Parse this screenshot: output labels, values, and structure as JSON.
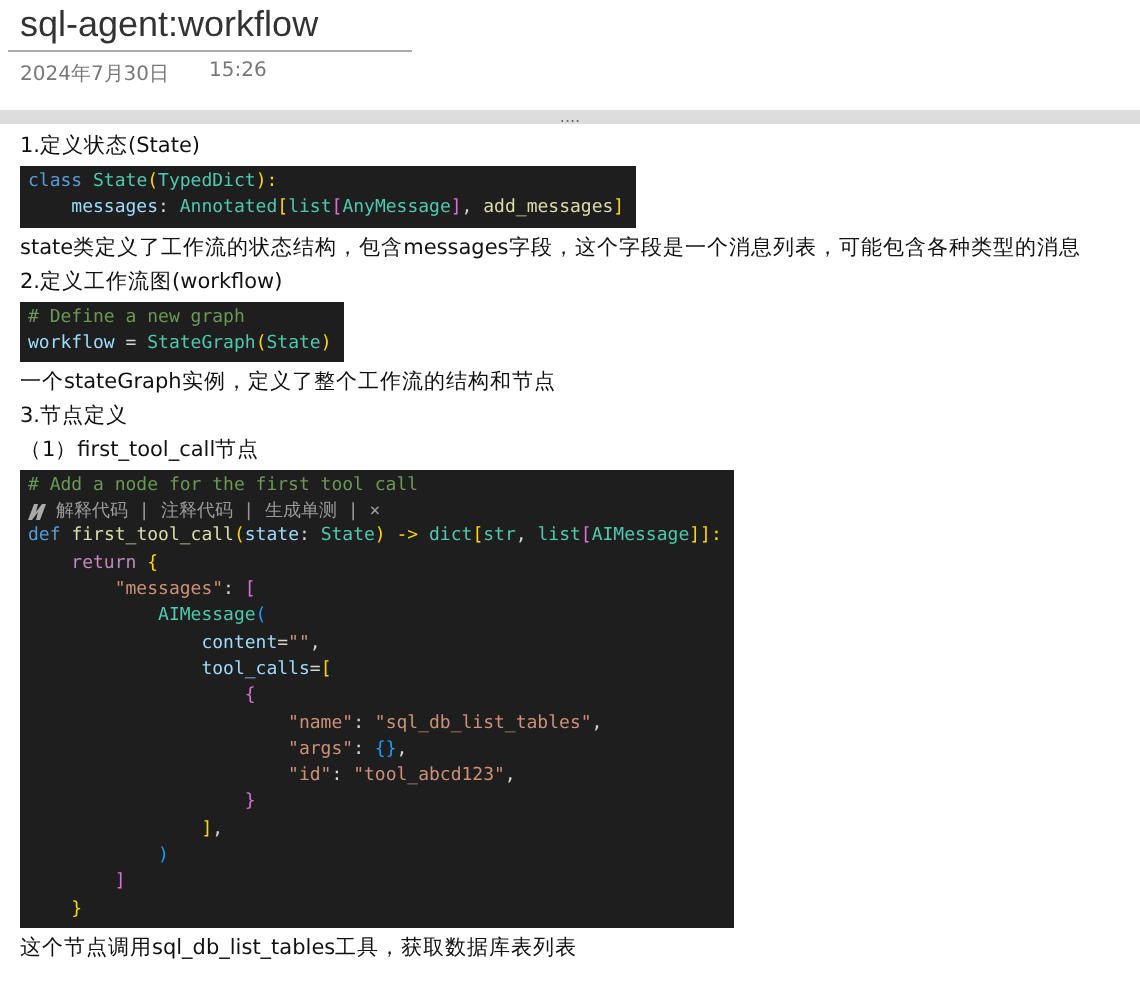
{
  "title": "sql-agent:workflow",
  "date": "2024年7月30日",
  "time": "15:26",
  "divider_handle": "....",
  "blocks": [
    {
      "kind": "text",
      "text": "1.定义状态(State)"
    },
    {
      "kind": "code",
      "lines": [
        [
          {
            "text": "class ",
            "color": "#569cd6"
          },
          {
            "text": "State",
            "color": "#4ec9b0"
          },
          {
            "text": "(",
            "color": "#ffd700"
          },
          {
            "text": "TypedDict",
            "color": "#4ec9b0"
          },
          {
            "text": "):",
            "color": "#ffd700"
          }
        ],
        [
          {
            "text": "    messages",
            "color": "#9cdcfe"
          },
          {
            "text": ": ",
            "color": "#d4d4d4"
          },
          {
            "text": "Annotated",
            "color": "#4ec9b0"
          },
          {
            "text": "[",
            "color": "#ffd700"
          },
          {
            "text": "list",
            "color": "#4ec9b0"
          },
          {
            "text": "[",
            "color": "#da70d6"
          },
          {
            "text": "AnyMessage",
            "color": "#4ec9b0"
          },
          {
            "text": "]",
            "color": "#da70d6"
          },
          {
            "text": ", ",
            "color": "#d4d4d4"
          },
          {
            "text": "add_messages",
            "color": "#dcdcaa"
          },
          {
            "text": "]",
            "color": "#ffd700"
          }
        ]
      ]
    },
    {
      "kind": "text",
      "text": "state类定义了工作流的状态结构，包含messages字段，这个字段是一个消息列表，可能包含各种类型的消息"
    },
    {
      "kind": "text",
      "text": "2.定义工作流图(workflow)"
    },
    {
      "kind": "code",
      "lines": [
        [
          {
            "text": "# Define a new graph",
            "color": "#6a9955"
          }
        ],
        [
          {
            "text": "workflow",
            "color": "#9cdcfe"
          },
          {
            "text": " = ",
            "color": "#d4d4d4"
          },
          {
            "text": "StateGraph",
            "color": "#4ec9b0"
          },
          {
            "text": "(",
            "color": "#ffd700"
          },
          {
            "text": "State",
            "color": "#4ec9b0"
          },
          {
            "text": ")",
            "color": "#ffd700"
          }
        ]
      ]
    },
    {
      "kind": "text",
      "text": "一个stateGraph实例，定义了整个工作流的结构和节点"
    },
    {
      "kind": "text",
      "text": "3.节点定义"
    },
    {
      "kind": "text",
      "text": "（1）first_tool_call节点"
    },
    {
      "kind": "code",
      "lens": "解释代码 | 注释代码 | 生成单测 | ×",
      "lines": [
        [
          {
            "text": "# Add a node for the first tool call",
            "color": "#6a9955"
          }
        ],
        [
          {
            "text": "def ",
            "color": "#569cd6"
          },
          {
            "text": "first_tool_call",
            "color": "#dcdcaa"
          },
          {
            "text": "(",
            "color": "#ffd700"
          },
          {
            "text": "state",
            "color": "#9cdcfe"
          },
          {
            "text": ": ",
            "color": "#d4d4d4"
          },
          {
            "text": "State",
            "color": "#4ec9b0"
          },
          {
            "text": ") -> ",
            "color": "#ffd700"
          },
          {
            "text": "dict",
            "color": "#4ec9b0"
          },
          {
            "text": "[",
            "color": "#ffd700"
          },
          {
            "text": "str",
            "color": "#4ec9b0"
          },
          {
            "text": ", ",
            "color": "#d4d4d4"
          },
          {
            "text": "list",
            "color": "#4ec9b0"
          },
          {
            "text": "[",
            "color": "#da70d6"
          },
          {
            "text": "AIMessage",
            "color": "#4ec9b0"
          },
          {
            "text": "]]:",
            "color": "#ffd700"
          }
        ],
        [
          {
            "text": "    return ",
            "color": "#c586c0"
          },
          {
            "text": "{",
            "color": "#ffd700"
          }
        ],
        [
          {
            "text": "        \"messages\"",
            "color": "#ce9178"
          },
          {
            "text": ": ",
            "color": "#d4d4d4"
          },
          {
            "text": "[",
            "color": "#da70d6"
          }
        ],
        [
          {
            "text": "            AIMessage",
            "color": "#4ec9b0"
          },
          {
            "text": "(",
            "color": "#179fff"
          }
        ],
        [
          {
            "text": "                content",
            "color": "#9cdcfe"
          },
          {
            "text": "=",
            "color": "#d4d4d4"
          },
          {
            "text": "\"\"",
            "color": "#ce9178"
          },
          {
            "text": ",",
            "color": "#d4d4d4"
          }
        ],
        [
          {
            "text": "                tool_calls",
            "color": "#9cdcfe"
          },
          {
            "text": "=",
            "color": "#d4d4d4"
          },
          {
            "text": "[",
            "color": "#ffd700"
          }
        ],
        [
          {
            "text": "                    {",
            "color": "#da70d6"
          }
        ],
        [
          {
            "text": "                        \"name\"",
            "color": "#ce9178"
          },
          {
            "text": ": ",
            "color": "#d4d4d4"
          },
          {
            "text": "\"sql_db_list_tables\"",
            "color": "#ce9178"
          },
          {
            "text": ",",
            "color": "#d4d4d4"
          }
        ],
        [
          {
            "text": "                        \"args\"",
            "color": "#ce9178"
          },
          {
            "text": ": ",
            "color": "#d4d4d4"
          },
          {
            "text": "{}",
            "color": "#179fff"
          },
          {
            "text": ",",
            "color": "#d4d4d4"
          }
        ],
        [
          {
            "text": "                        \"id\"",
            "color": "#ce9178"
          },
          {
            "text": ": ",
            "color": "#d4d4d4"
          },
          {
            "text": "\"tool_abcd123\"",
            "color": "#ce9178"
          },
          {
            "text": ",",
            "color": "#d4d4d4"
          }
        ],
        [
          {
            "text": "                    }",
            "color": "#da70d6"
          }
        ],
        [
          {
            "text": "                ]",
            "color": "#ffd700"
          },
          {
            "text": ",",
            "color": "#d4d4d4"
          }
        ],
        [
          {
            "text": "            )",
            "color": "#179fff"
          }
        ],
        [
          {
            "text": "        ]",
            "color": "#da70d6"
          }
        ],
        [
          {
            "text": "    }",
            "color": "#ffd700"
          }
        ]
      ]
    },
    {
      "kind": "text",
      "text": "这个节点调用sql_db_list_tables工具，获取数据库表列表"
    }
  ]
}
